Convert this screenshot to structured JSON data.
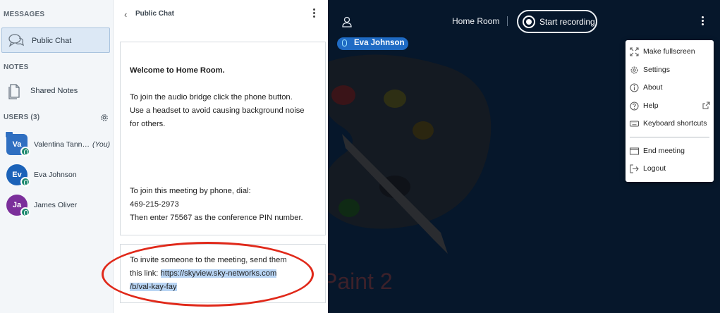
{
  "sidebar": {
    "messages_title": "MESSAGES",
    "public_chat_label": "Public Chat",
    "notes_title": "NOTES",
    "shared_notes_label": "Shared Notes",
    "users_title": "USERS (3)",
    "users": [
      {
        "initials": "Va",
        "name": "Valentina Tann…",
        "suffix": "(You)",
        "color": "#2f6fc1"
      },
      {
        "initials": "Ev",
        "name": "Eva Johnson",
        "suffix": "",
        "color": "#1b62b8"
      },
      {
        "initials": "Ja",
        "name": "James Oliver",
        "suffix": "",
        "color": "#7b2f9b"
      }
    ]
  },
  "chat": {
    "title": "Public Chat",
    "welcome_prefix": "Welcome to ",
    "welcome_room": "Home Room",
    "welcome_suffix": ".",
    "audio_line1": "To join the audio bridge click the phone button.",
    "audio_line2": "Use a headset to avoid causing background noise",
    "audio_line3": "for others.",
    "phone_intro": "To join this meeting by phone, dial:",
    "phone_number": "469-215-2973",
    "pin_line": "Then enter 75567 as the conference PIN number.",
    "invite_line1": "To invite someone to the meeting, send them",
    "invite_line2_prefix": "this link: ",
    "invite_link_part1": "https://skyview.sky-networks.com",
    "invite_link_part2": "/b/val-kay-fay"
  },
  "stage": {
    "room_name": "Home Room",
    "record_label": "Start recording",
    "talker_name": "Eva Johnson",
    "slide_label": "Paint 2"
  },
  "options_menu": {
    "items": [
      {
        "label": "Make fullscreen",
        "icon": "fullscreen-icon"
      },
      {
        "label": "Settings",
        "icon": "gear-icon"
      },
      {
        "label": "About",
        "icon": "info-icon"
      },
      {
        "label": "Help",
        "icon": "help-icon"
      },
      {
        "label": "Keyboard shortcuts",
        "icon": "keyboard-icon"
      },
      {
        "label": "End meeting",
        "icon": "end-meeting-icon"
      },
      {
        "label": "Logout",
        "icon": "logout-icon"
      }
    ]
  },
  "colors": {
    "stage_bg": "#06172b",
    "accent_blue": "#1f6bc4",
    "mic_green": "#1f8a6f",
    "annotation_red": "#e0291a",
    "link_highlight": "#b9d5f4"
  }
}
